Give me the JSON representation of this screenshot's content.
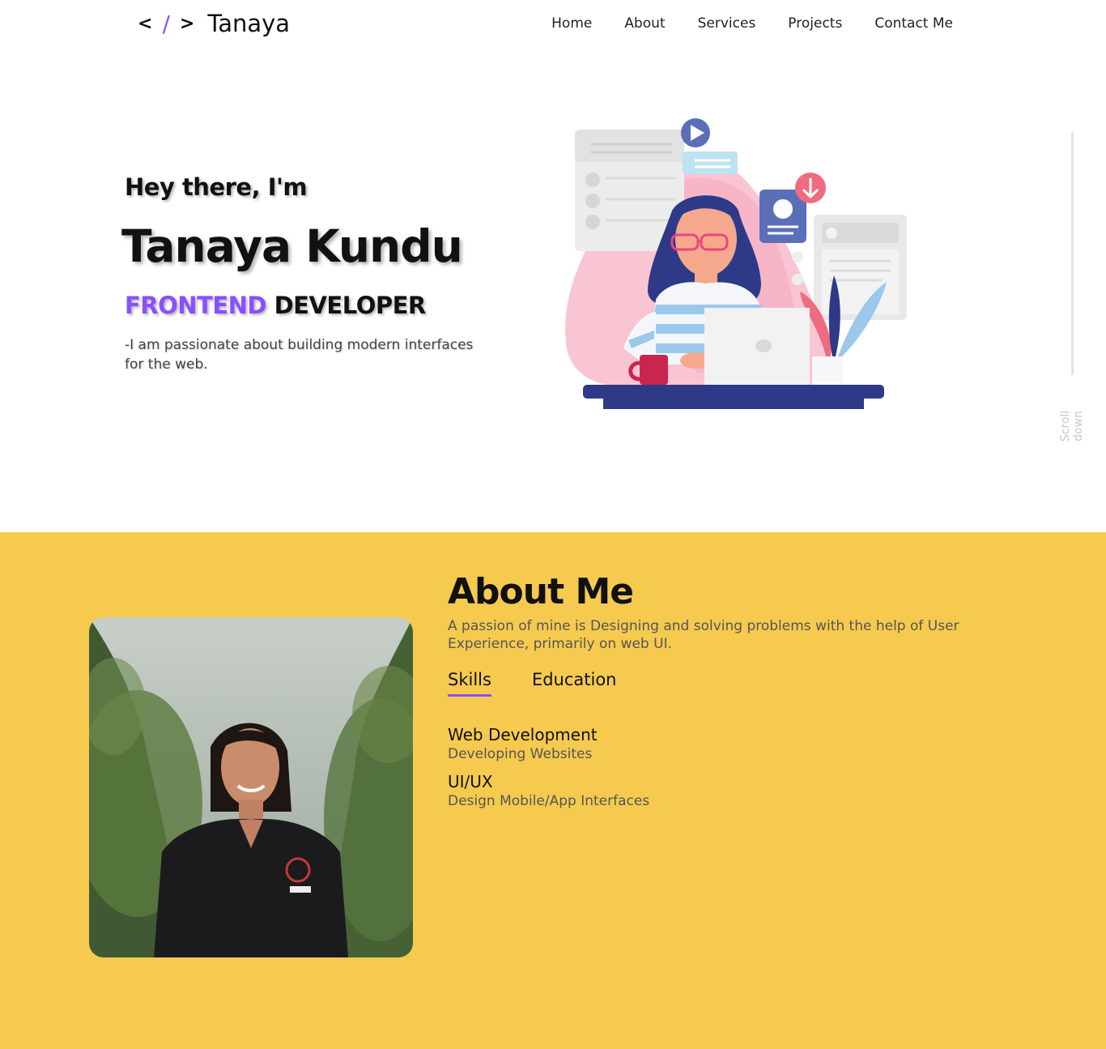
{
  "header": {
    "logo_open": "<",
    "logo_slash": "/",
    "logo_close": ">",
    "logo_name": "Tanaya"
  },
  "nav": {
    "items": [
      "Home",
      "About",
      "Services",
      "Projects",
      "Contact Me"
    ]
  },
  "hero": {
    "greeting": "Hey there, I'm",
    "name": "Tanaya Kundu",
    "role_accent": "FRONTEND",
    "role_rest": "DEVELOPER",
    "description": "-I am passionate about building modern interfaces for the web."
  },
  "scroll": {
    "label": "Scroll down"
  },
  "about": {
    "title": "About Me",
    "description": "A passion of mine is Designing and solving problems with the help of User Experience, primarily on web UI.",
    "tabs": [
      "Skills",
      "Education"
    ],
    "skills": [
      {
        "title": "Web Development",
        "subtitle": "Developing Websites"
      },
      {
        "title": "UI/UX",
        "subtitle": "Design Mobile/App Interfaces"
      }
    ]
  },
  "colors": {
    "accent": "#8a4fff",
    "about_bg": "#f5ca4f"
  }
}
